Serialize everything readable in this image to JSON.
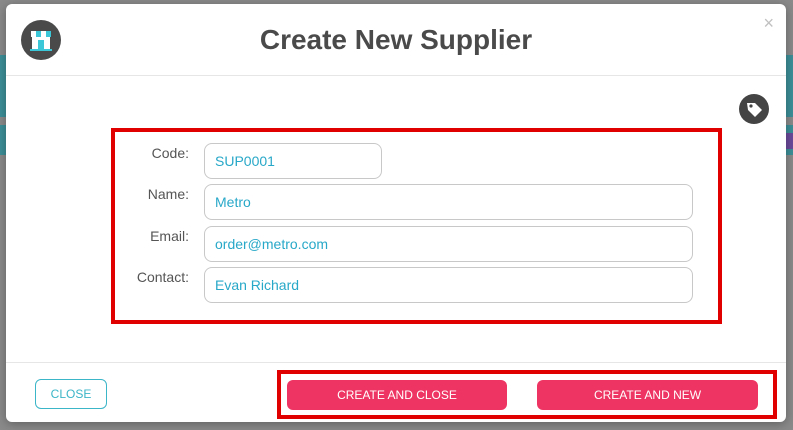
{
  "dialog": {
    "title": "Create New Supplier",
    "close_symbol": "×",
    "logo_icon": "store-logo-icon",
    "tag_icon": "tag-icon"
  },
  "form": {
    "code": {
      "label": "Code:",
      "value": "SUP0001"
    },
    "name": {
      "label": "Name:",
      "value": "Metro"
    },
    "email": {
      "label": "Email:",
      "value": "order@metro.com"
    },
    "contact": {
      "label": "Contact:",
      "value": "Evan Richard"
    }
  },
  "footer": {
    "close_label": "CLOSE",
    "create_close_label": "CREATE AND CLOSE",
    "create_new_label": "CREATE AND NEW"
  },
  "colors": {
    "accent": "#ee3462",
    "teal": "#3bb5c8",
    "highlight": "#e00000"
  }
}
